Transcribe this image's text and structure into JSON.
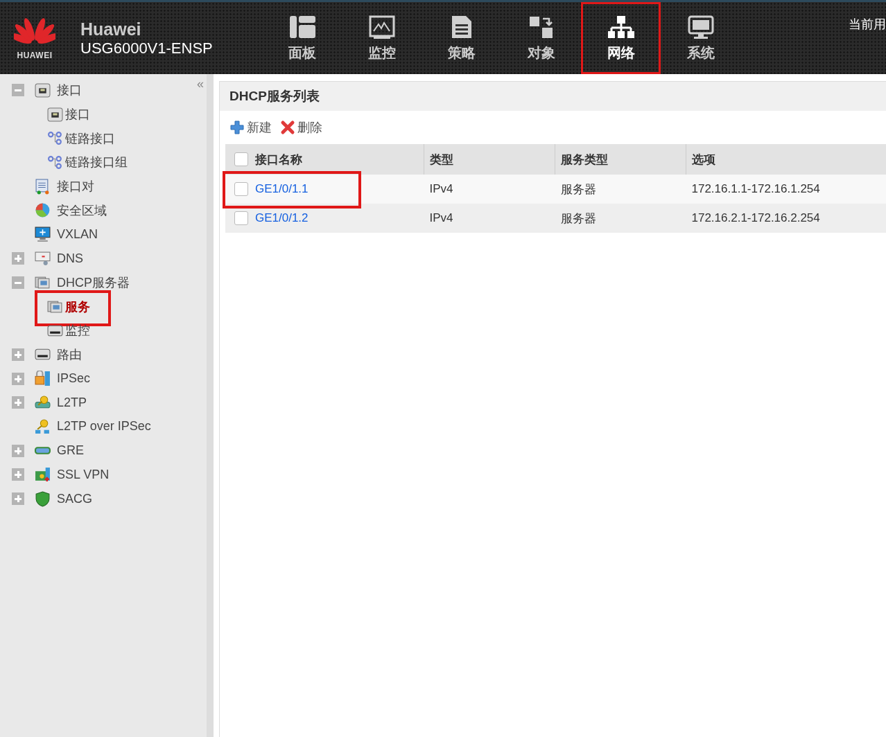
{
  "header": {
    "logo_text": "HUAWEI",
    "brand": "Huawei",
    "device": "USG6000V1-ENSP",
    "user_text": "当前用",
    "nav": [
      {
        "label": "面板",
        "selected": false,
        "highlighted": false
      },
      {
        "label": "监控",
        "selected": false,
        "highlighted": false
      },
      {
        "label": "策略",
        "selected": false,
        "highlighted": false
      },
      {
        "label": "对象",
        "selected": false,
        "highlighted": false
      },
      {
        "label": "网络",
        "selected": true,
        "highlighted": true
      },
      {
        "label": "系统",
        "selected": false,
        "highlighted": false
      }
    ]
  },
  "sidebar": {
    "collapse_glyph": "«",
    "items": [
      {
        "label": "接口",
        "kind": "folder",
        "expanded": true,
        "selected": false,
        "highlighted": false,
        "children": [
          {
            "label": "接口",
            "selected": false,
            "highlighted": false
          },
          {
            "label": "链路接口",
            "selected": false,
            "highlighted": false
          },
          {
            "label": "链路接口组",
            "selected": false,
            "highlighted": false
          }
        ]
      },
      {
        "label": "接口对",
        "kind": "leaf",
        "selected": false,
        "highlighted": false
      },
      {
        "label": "安全区域",
        "kind": "leaf",
        "selected": false,
        "highlighted": false
      },
      {
        "label": "VXLAN",
        "kind": "leaf",
        "selected": false,
        "highlighted": false
      },
      {
        "label": "DNS",
        "kind": "folder",
        "expanded": false,
        "selected": false,
        "highlighted": false
      },
      {
        "label": "DHCP服务器",
        "kind": "folder",
        "expanded": true,
        "selected": false,
        "highlighted": false,
        "children": [
          {
            "label": "服务",
            "selected": true,
            "highlighted": true
          },
          {
            "label": "监控",
            "selected": false,
            "highlighted": false
          }
        ]
      },
      {
        "label": "路由",
        "kind": "folder",
        "expanded": false,
        "selected": false,
        "highlighted": false
      },
      {
        "label": "IPSec",
        "kind": "folder",
        "expanded": false,
        "selected": false,
        "highlighted": false
      },
      {
        "label": "L2TP",
        "kind": "folder",
        "expanded": false,
        "selected": false,
        "highlighted": false
      },
      {
        "label": "L2TP over IPSec",
        "kind": "leaf",
        "selected": false,
        "highlighted": false
      },
      {
        "label": "GRE",
        "kind": "folder",
        "expanded": false,
        "selected": false,
        "highlighted": false
      },
      {
        "label": "SSL VPN",
        "kind": "folder",
        "expanded": false,
        "selected": false,
        "highlighted": false
      },
      {
        "label": "SACG",
        "kind": "folder",
        "expanded": false,
        "selected": false,
        "highlighted": false
      }
    ]
  },
  "panel": {
    "title": "DHCP服务列表",
    "toolbar": [
      {
        "label": "新建",
        "kind": "add"
      },
      {
        "label": "删除",
        "kind": "delete"
      }
    ],
    "table": {
      "columns": [
        "接口名称",
        "类型",
        "服务类型",
        "选项"
      ],
      "all_checked": false,
      "rows": [
        {
          "name": "GE1/0/1.1",
          "type": "IPv4",
          "service_type": "服务器",
          "options": "172.16.1.1-172.16.1.254",
          "checked": false,
          "highlighted": true
        },
        {
          "name": "GE1/0/1.2",
          "type": "IPv4",
          "service_type": "服务器",
          "options": "172.16.2.1-172.16.2.254",
          "checked": false,
          "highlighted": false
        }
      ]
    }
  }
}
